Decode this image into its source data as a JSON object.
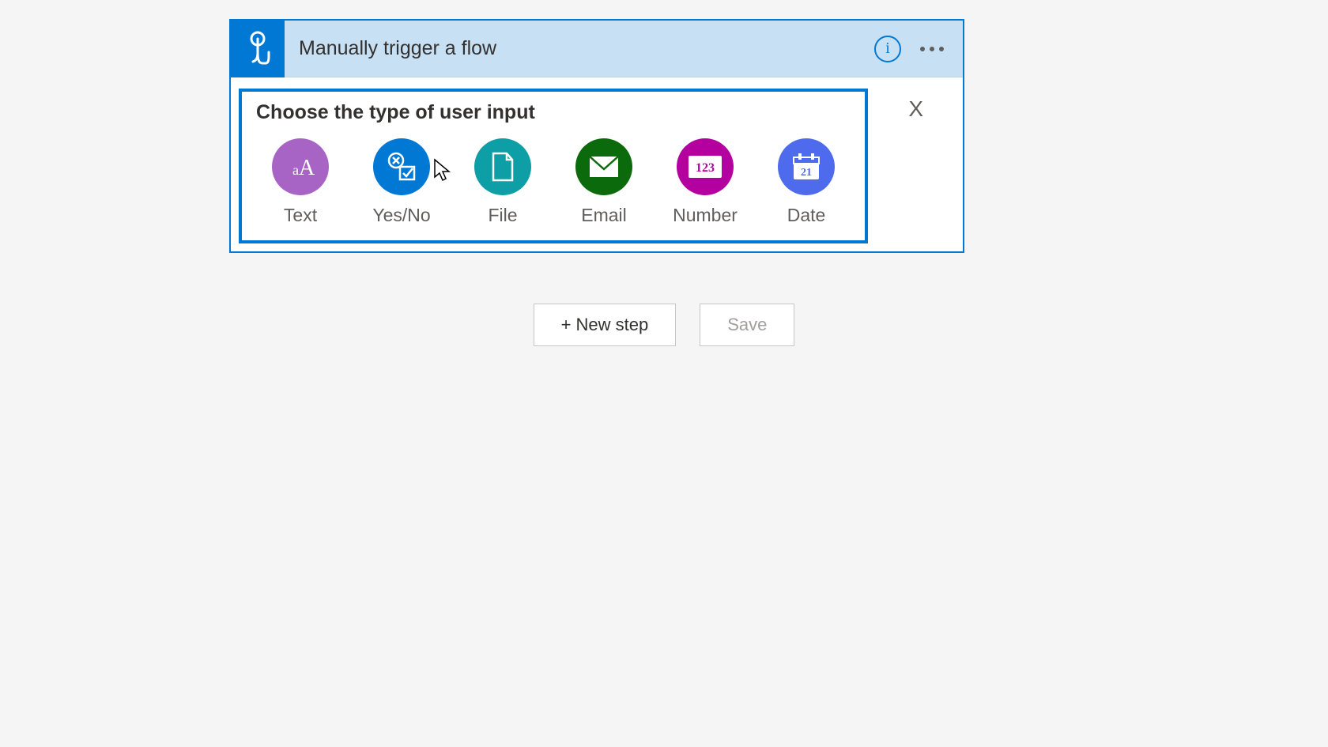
{
  "trigger": {
    "title": "Manually trigger a flow"
  },
  "input_panel": {
    "title": "Choose the type of user input",
    "close": "X",
    "options": [
      {
        "label": "Text"
      },
      {
        "label": "Yes/No"
      },
      {
        "label": "File"
      },
      {
        "label": "Email"
      },
      {
        "label": "Number"
      },
      {
        "label": "Date"
      }
    ]
  },
  "actions": {
    "new_step": "+ New step",
    "save": "Save"
  }
}
